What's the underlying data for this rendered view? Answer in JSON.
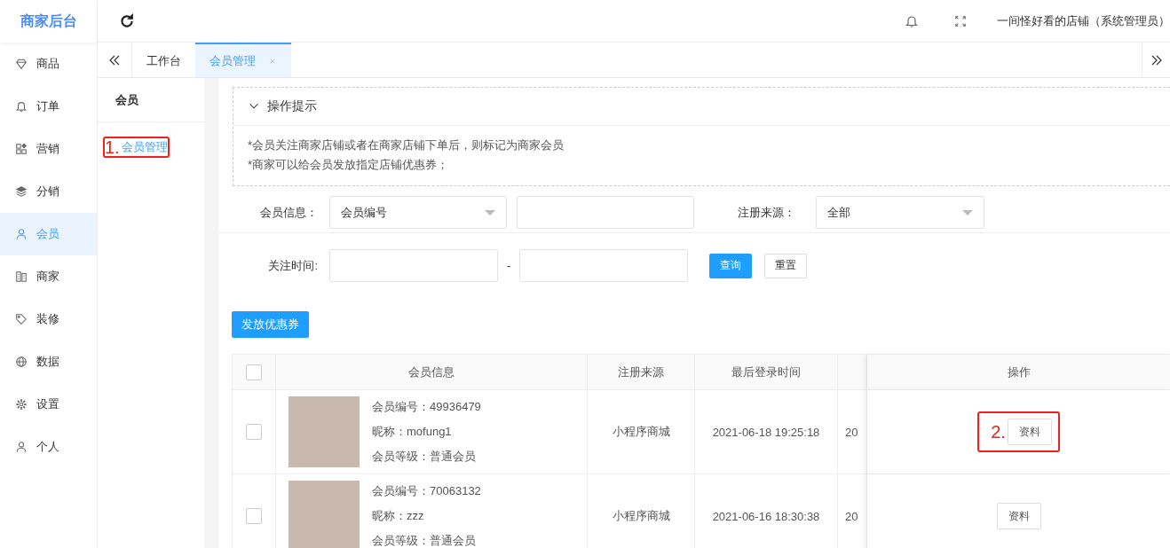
{
  "sidebar": {
    "logo": "商家后台",
    "items": [
      {
        "label": "商品",
        "selected": false
      },
      {
        "label": "订单",
        "selected": false
      },
      {
        "label": "营销",
        "selected": false
      },
      {
        "label": "分销",
        "selected": false
      },
      {
        "label": "会员",
        "selected": true
      },
      {
        "label": "商家",
        "selected": false
      },
      {
        "label": "装修",
        "selected": false
      },
      {
        "label": "数据",
        "selected": false
      },
      {
        "label": "设置",
        "selected": false
      },
      {
        "label": "个人",
        "selected": false
      }
    ]
  },
  "toolbar": {
    "user": "一间怪好看的店铺（系统管理员）"
  },
  "tabs": [
    {
      "label": "工作台",
      "selected": false,
      "closable": false
    },
    {
      "label": "会员管理",
      "selected": true,
      "closable": true
    }
  ],
  "subnav": {
    "title": "会员",
    "items": [
      {
        "label": "会员管理",
        "selected": true,
        "annotation": "1."
      }
    ]
  },
  "tips": {
    "title": "操作提示",
    "expanded": true,
    "lines": [
      "*会员关注商家店铺或者在商家店铺下单后，则标记为商家会员",
      "*商家可以给会员发放指定店铺优惠券；"
    ]
  },
  "filters": {
    "member_info": {
      "label": "会员信息：",
      "select": "会员编号"
    },
    "source": {
      "label": "注册来源：",
      "select": "全部"
    },
    "follow_time": {
      "label": "关注时间:",
      "separator": "-"
    },
    "buttons": [
      {
        "label": "查询",
        "kind": "primary"
      },
      {
        "label": "重置",
        "kind": "default"
      }
    ]
  },
  "issue_button": "发放优惠券",
  "table": {
    "select_all": {
      "checked": false
    },
    "columns": [
      "会员信息",
      "注册来源",
      "最后登录时间",
      "操作"
    ],
    "rows": [
      {
        "checked": false,
        "member_no": "会员编号：49936479",
        "nickname": "昵称：mofung1",
        "level": "会员等级：普通会员",
        "source": "小程序商城",
        "last_login": "2021-06-18 19:25:18",
        "column_5": "20",
        "action": "资料",
        "annotation": "2."
      },
      {
        "checked": false,
        "member_no": "会员编号：70063132",
        "nickname": "昵称：zzz",
        "level": "会员等级：普通会员",
        "source": "小程序商城",
        "last_login": "2021-06-16 18:30:38",
        "column_5": "20",
        "action": "资料"
      }
    ]
  }
}
